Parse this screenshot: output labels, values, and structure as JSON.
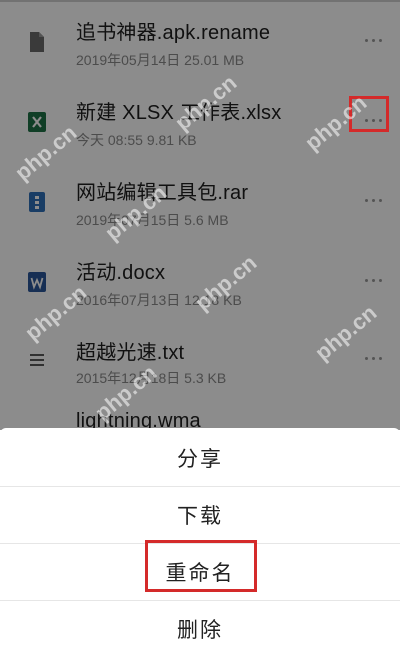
{
  "files": [
    {
      "name": "追书神器.apk.rename",
      "meta": "2019年05月14日 25.01 MB",
      "icon": "generic-file-icon",
      "icon_color": "#6b6b6b"
    },
    {
      "name": "新建 XLSX 工作表.xlsx",
      "meta": "今天 08:55 9.81 KB",
      "icon": "excel-file-icon",
      "icon_color": "#1e7145"
    },
    {
      "name": "网站编辑工具包.rar",
      "meta": "2019年07月15日 5.6 MB",
      "icon": "archive-file-icon",
      "icon_color": "#2f6fb8"
    },
    {
      "name": "活动.docx",
      "meta": "2016年07月13日 12.18 KB",
      "icon": "word-file-icon",
      "icon_color": "#2b579a"
    },
    {
      "name": "超越光速.txt",
      "meta": "2015年12月18日 5.3 KB",
      "icon": "text-file-icon",
      "icon_color": "#5a5a5a"
    },
    {
      "name": "lightning.wma",
      "meta": "",
      "icon": "audio-file-icon",
      "icon_color": "#5a5a5a"
    }
  ],
  "action_sheet": {
    "share_label": "分享",
    "download_label": "下载",
    "rename_label": "重命名",
    "delete_label": "删除"
  },
  "watermark_text": "php.cn",
  "colors": {
    "highlight": "#d42a2a",
    "overlay": "rgba(0,0,0,0.45)"
  }
}
